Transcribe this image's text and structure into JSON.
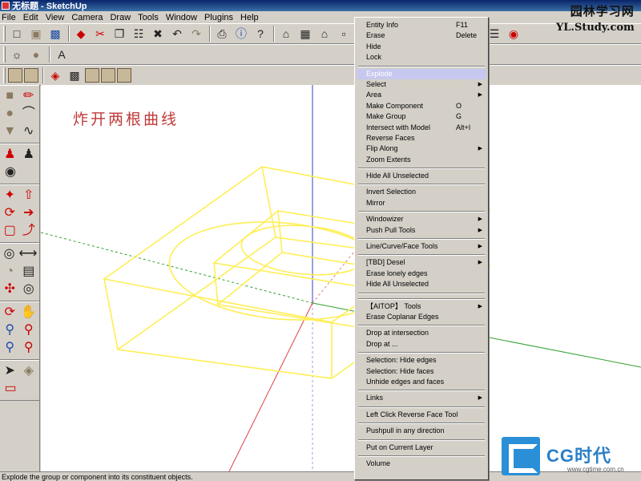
{
  "window": {
    "title": "无标题 - SketchUp"
  },
  "menubar": [
    "File",
    "Edit",
    "View",
    "Camera",
    "Draw",
    "Tools",
    "Window",
    "Plugins",
    "Help"
  ],
  "canvas": {
    "caption": "炸开两根曲线"
  },
  "status": {
    "text": "Explode the group or component into its constituent objects."
  },
  "context_menu": {
    "items": [
      {
        "type": "item",
        "label": "Entity Info",
        "shortcut": "F11"
      },
      {
        "type": "item",
        "label": "Erase",
        "shortcut": "Delete"
      },
      {
        "type": "item",
        "label": "Hide"
      },
      {
        "type": "item",
        "label": "Lock"
      },
      {
        "type": "sep"
      },
      {
        "type": "item",
        "label": "Explode",
        "highlighted": true
      },
      {
        "type": "item",
        "label": "Select",
        "submenu": true
      },
      {
        "type": "item",
        "label": "Area",
        "submenu": true
      },
      {
        "type": "item",
        "label": "Make Component",
        "shortcut": "O"
      },
      {
        "type": "item",
        "label": "Make Group",
        "shortcut": "G"
      },
      {
        "type": "item",
        "label": "Intersect with Model",
        "shortcut": "Alt+I"
      },
      {
        "type": "item",
        "label": "Reverse Faces"
      },
      {
        "type": "item",
        "label": "Flip Along",
        "submenu": true
      },
      {
        "type": "item",
        "label": "Zoom Extents"
      },
      {
        "type": "sep"
      },
      {
        "type": "item",
        "label": "Hide All Unselected"
      },
      {
        "type": "sep"
      },
      {
        "type": "item",
        "label": "Invert Selection"
      },
      {
        "type": "item",
        "label": "Mirror"
      },
      {
        "type": "sep"
      },
      {
        "type": "item",
        "label": "Windowizer",
        "submenu": true
      },
      {
        "type": "item",
        "label": "Push Pull Tools",
        "submenu": true
      },
      {
        "type": "sep"
      },
      {
        "type": "item",
        "label": "Line/Curve/Face Tools",
        "submenu": true
      },
      {
        "type": "sep"
      },
      {
        "type": "item",
        "label": "[TBD] Desel",
        "submenu": true
      },
      {
        "type": "item",
        "label": "Erase lonely edges"
      },
      {
        "type": "item",
        "label": "Hide All Unselected"
      },
      {
        "type": "sep"
      },
      {
        "type": "sep"
      },
      {
        "type": "item",
        "label": "【AITOP】 Tools",
        "submenu": true
      },
      {
        "type": "item",
        "label": "Erase Coplanar Edges"
      },
      {
        "type": "sep"
      },
      {
        "type": "item",
        "label": "Drop at intersection"
      },
      {
        "type": "item",
        "label": "Drop at ..."
      },
      {
        "type": "sep"
      },
      {
        "type": "item",
        "label": "Selection: Hide edges"
      },
      {
        "type": "item",
        "label": "Selection: Hide faces"
      },
      {
        "type": "item",
        "label": "Unhide edges and faces"
      },
      {
        "type": "sep"
      },
      {
        "type": "item",
        "label": "Links",
        "submenu": true
      },
      {
        "type": "sep"
      },
      {
        "type": "item",
        "label": "Left Click Reverse Face Tool"
      },
      {
        "type": "sep"
      },
      {
        "type": "item",
        "label": "Pushpull in any direction"
      },
      {
        "type": "sep"
      },
      {
        "type": "item",
        "label": "Put on Current Layer"
      },
      {
        "type": "sep"
      },
      {
        "type": "item",
        "label": "Volume"
      }
    ]
  },
  "watermarks": {
    "top_cn": "园林学习网",
    "top_en": "YL.Study.com",
    "bottom_brand": "CG时代",
    "bottom_url": "www.cgtime.com.cn"
  },
  "colors": {
    "selection_yellow": "#ffee55",
    "axis_red": "#e04040",
    "axis_green": "#30a030",
    "axis_blue": "#3040c0",
    "caption_red": "#c03a3a",
    "menu_highlight": "#c7c8ef"
  }
}
